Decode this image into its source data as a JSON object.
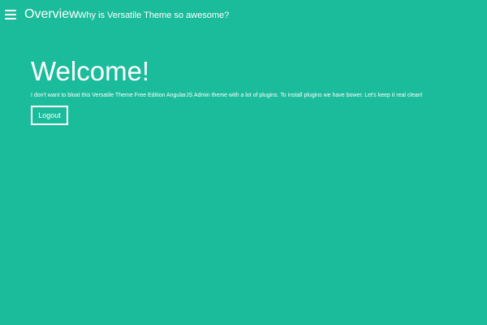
{
  "colors": {
    "background": "#1bbc9b",
    "foreground": "#ffffff"
  },
  "header": {
    "menu_icon": "hamburger-menu-icon",
    "title": "Overview",
    "subtitle": "Why is Versatile Theme so awesome?"
  },
  "main": {
    "heading": "Welcome!",
    "description": "I don't want to bloat this Versatile Theme Free Edition AngularJS Admin theme with a lot of plugins. To install plugins we have bower. Let's keep it real clean!",
    "logout_label": "Logout"
  }
}
